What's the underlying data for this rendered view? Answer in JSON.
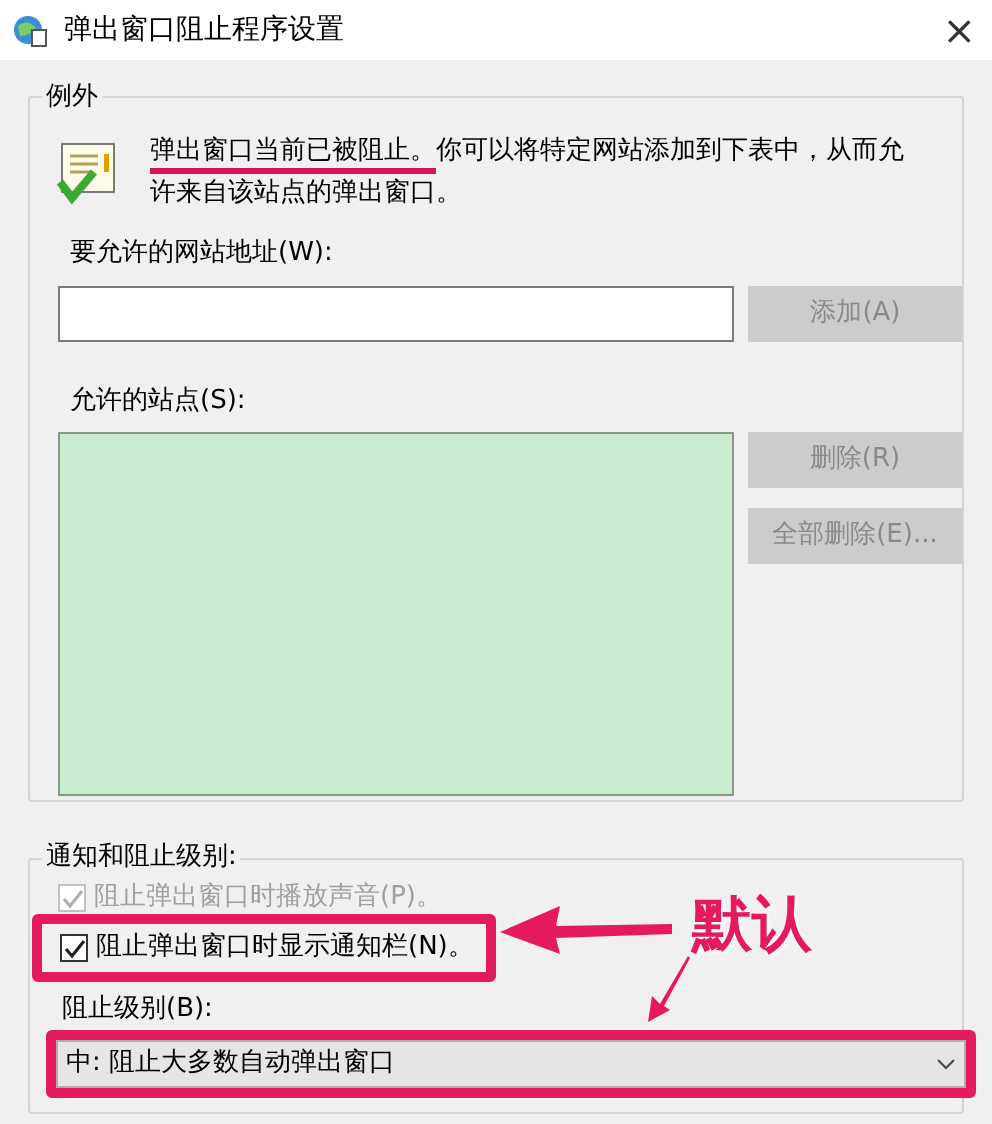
{
  "window": {
    "title": "弹出窗口阻止程序设置",
    "close": "×"
  },
  "exceptions": {
    "legend": "例外",
    "message": {
      "marked": "弹出窗口当前已被阻止。",
      "rest": "你可以将特定网站添加到下表中，从而允许来自该站点的弹出窗口。"
    },
    "address_label": "要允许的网站地址(W):",
    "add_button": {
      "label": "添加(A)",
      "disabled": true
    },
    "sites_label": "允许的站点(S):",
    "buttons": [
      {
        "label": "删除(R)",
        "disabled": true
      },
      {
        "label": "全部删除(E)...",
        "disabled": true
      }
    ]
  },
  "notifications": {
    "legend": "通知和阻止级别:",
    "options": [
      {
        "label": "阻止弹出窗口时播放声音(P)。",
        "checked": true,
        "disabled": true
      },
      {
        "label": "阻止弹出窗口时显示通知栏(N)。",
        "checked": true,
        "disabled": false
      }
    ],
    "level_label": "阻止级别(B):",
    "level_value": "中: 阻止大多数自动弹出窗口"
  },
  "annotation": {
    "text": "默认"
  }
}
